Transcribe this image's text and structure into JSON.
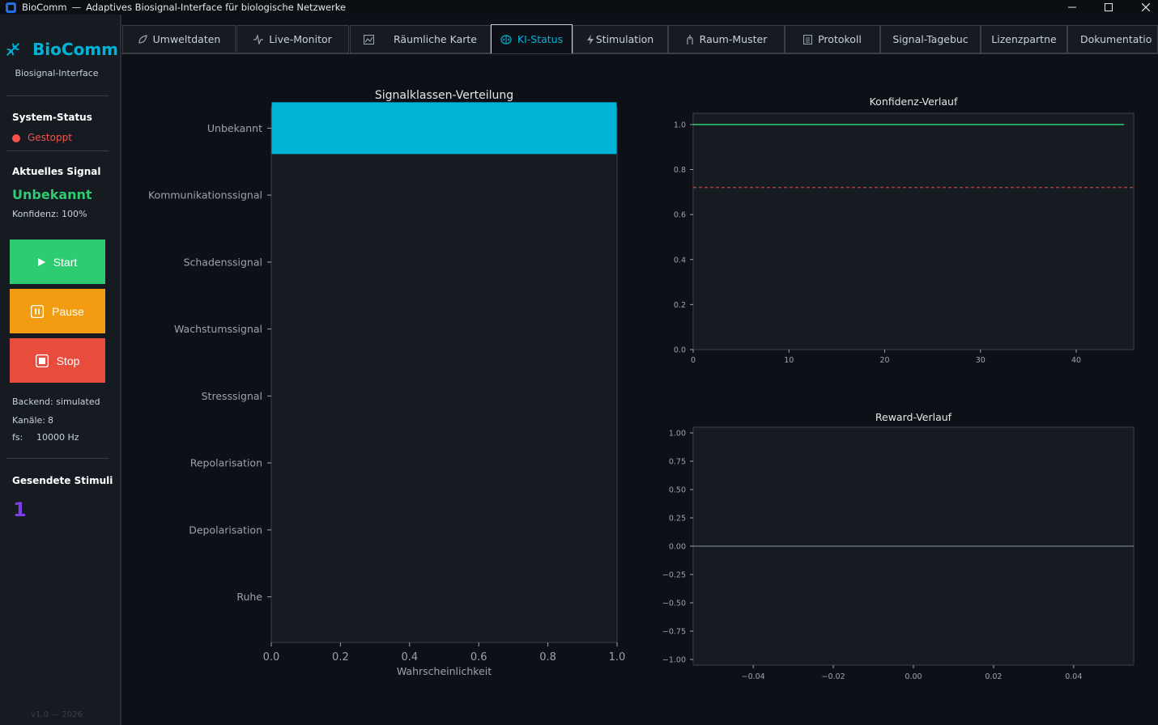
{
  "window": {
    "app_name": "BioComm",
    "separator": "—",
    "subtitle": "Adaptives Biosignal-Interface für biologische Netzwerke"
  },
  "sidebar": {
    "brand": "BioComm",
    "brand_sub": "Biosignal-Interface",
    "system_status_label": "System-Status",
    "system_status_value": "Gestoppt",
    "current_signal_label": "Aktuelles Signal",
    "current_signal_value": "Unbekannt",
    "confidence_text": "Konfidenz: 100%",
    "buttons": {
      "start": "Start",
      "pause": "Pause",
      "stop": "Stop"
    },
    "backend_text": "Backend: simulated",
    "channels_label": "Kanäle:",
    "channels_value": "8",
    "fs_label": "fs:",
    "fs_value": "10000 Hz",
    "stimuli_label": "Gesendete Stimuli",
    "stimuli_count": "1",
    "version": "v1.0 — 2026"
  },
  "tabs": [
    {
      "label": "Umweltdaten",
      "icon": "leaf-icon"
    },
    {
      "label": "Live-Monitor",
      "icon": "wave-icon"
    },
    {
      "label": "Räumliche Karte",
      "icon": "map-icon"
    },
    {
      "label": "KI-Status",
      "icon": "brain-icon",
      "active": true
    },
    {
      "label": "Stimulation",
      "icon": "bolt-icon"
    },
    {
      "label": "Raum-Muster",
      "icon": "pattern-icon"
    },
    {
      "label": "Protokoll",
      "icon": "document-icon"
    },
    {
      "label": "Signal-Tagebuc",
      "icon": ""
    },
    {
      "label": "Lizenzpartne",
      "icon": ""
    },
    {
      "label": "Dokumentatio",
      "icon": ""
    }
  ],
  "colors": {
    "accent": "#00b4d8",
    "status_stopped": "#f85149",
    "signal_green": "#2ecc71",
    "stimuli_purple": "#7b3fe4",
    "bar": "#00b4d8",
    "confidence_line": "#2ecc71",
    "threshold_line": "#e74c3c"
  },
  "chart_data": [
    {
      "type": "bar",
      "orientation": "horizontal",
      "title": "Signalklassen-Verteilung",
      "xlabel": "Wahrscheinlichkeit",
      "ylabel": "",
      "categories": [
        "Unbekannt",
        "Kommunikationssignal",
        "Schadenssignal",
        "Wachstumssignal",
        "Stresssignal",
        "Repolarisation",
        "Depolarisation",
        "Ruhe"
      ],
      "values": [
        1.0,
        0,
        0,
        0,
        0,
        0,
        0,
        0
      ],
      "xlim": [
        0,
        1
      ],
      "xticks": [
        "0.0",
        "0.2",
        "0.4",
        "0.6",
        "0.8",
        "1.0"
      ],
      "grid": false
    },
    {
      "type": "line",
      "title": "Konfidenz-Verlauf",
      "xlabel": "",
      "ylabel": "",
      "xlim": [
        0,
        46
      ],
      "ylim": [
        0,
        1.05
      ],
      "xticks": [
        "0",
        "10",
        "20",
        "30",
        "40"
      ],
      "yticks": [
        "0.0",
        "0.2",
        "0.4",
        "0.6",
        "0.8",
        "1.0"
      ],
      "series": [
        {
          "x": [
            0,
            45
          ],
          "values": [
            1.0,
            1.0
          ],
          "style": "solid"
        }
      ],
      "reference_line": {
        "y": 0.72,
        "style": "dashed"
      },
      "grid": false
    },
    {
      "type": "line",
      "title": "Reward-Verlauf",
      "xlabel": "",
      "ylabel": "",
      "xlim": [
        -0.055,
        0.055
      ],
      "ylim": [
        -1.05,
        1.05
      ],
      "xticks": [
        "−0.04",
        "−0.02",
        "0.00",
        "0.02",
        "0.04"
      ],
      "yticks": [
        "1.00",
        "0.75",
        "0.50",
        "0.25",
        "0.00",
        "−0.25",
        "−0.50",
        "−0.75",
        "−1.00"
      ],
      "series": [],
      "reference_line": {
        "y": 0.0,
        "style": "solid"
      },
      "grid": false
    }
  ]
}
